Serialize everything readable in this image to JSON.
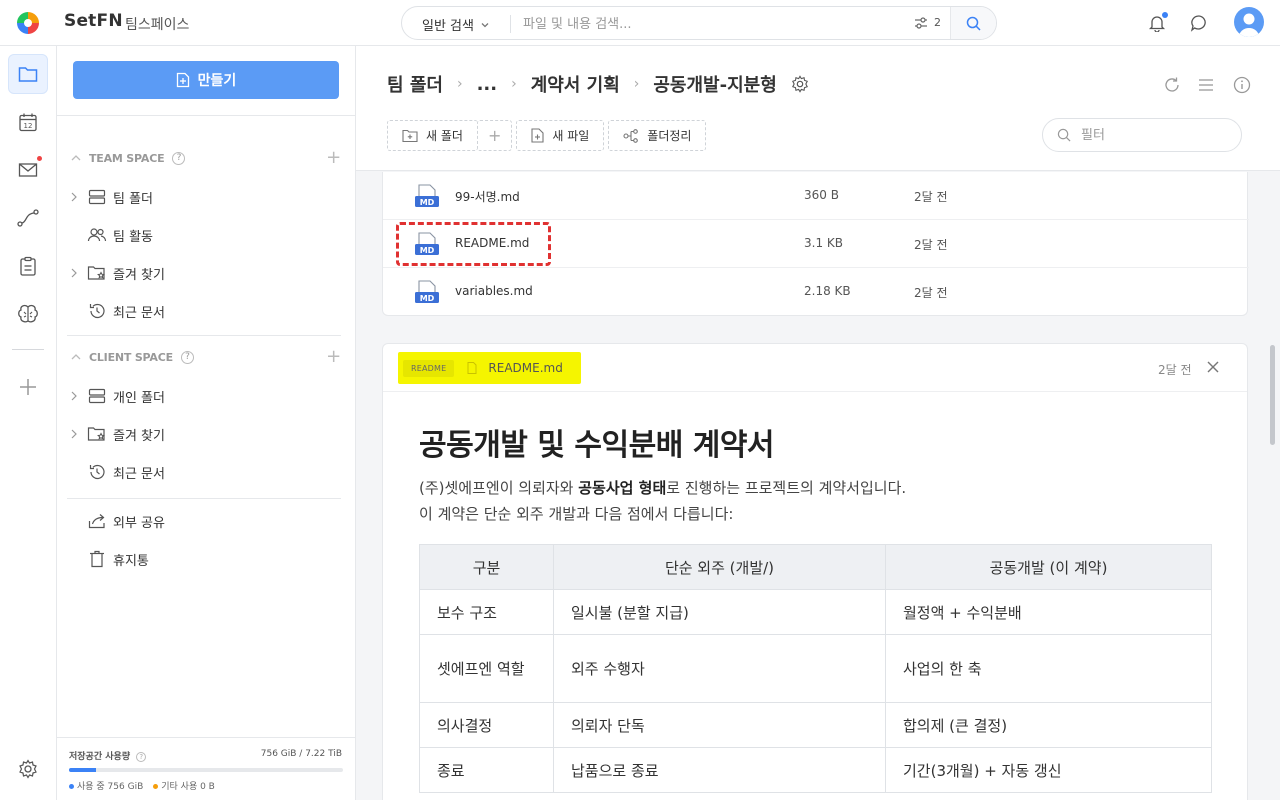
{
  "app": {
    "brand": "SetFN",
    "workspace": "팀스페이스"
  },
  "search": {
    "mode": "일반 검색",
    "placeholder": "파일 및 내용 검색...",
    "filter_count": "2"
  },
  "sidebar": {
    "create_label": "만들기",
    "team_space": {
      "title": "TEAM SPACE",
      "items": [
        {
          "label": "팀 폴더"
        },
        {
          "label": "팀 활동"
        },
        {
          "label": "즐겨 찾기"
        },
        {
          "label": "최근 문서"
        }
      ]
    },
    "client_space": {
      "title": "CLIENT SPACE",
      "items": [
        {
          "label": "개인 폴더"
        },
        {
          "label": "즐겨 찾기"
        },
        {
          "label": "최근 문서"
        }
      ]
    },
    "extra_items": [
      {
        "label": "외부 공유"
      },
      {
        "label": "휴지통"
      }
    ],
    "storage": {
      "title": "저장공간 사용량",
      "value": "756 GiB / 7.22 TiB",
      "used_fraction": 0.1,
      "legend_used": "사용 중 756 GiB",
      "legend_other": "기타 사용 0 B",
      "color_used": "#3b82f6",
      "color_other": "#f59e0b"
    }
  },
  "breadcrumb": {
    "items": [
      "팀 폴더",
      "...",
      "계약서 기획",
      "공동개발-지분형"
    ]
  },
  "actions": {
    "new_folder": "새 폴더",
    "new_file": "새 파일",
    "organize": "폴더정리",
    "filter_placeholder": "필터"
  },
  "files": [
    {
      "name": "99-서명.md",
      "size": "360 B",
      "date": "2달 전",
      "icon": "md-file-icon"
    },
    {
      "name": "README.md",
      "size": "3.1 KB",
      "date": "2달 전",
      "icon": "md-file-icon"
    },
    {
      "name": "variables.md",
      "size": "2.18 KB",
      "date": "2달 전",
      "icon": "md-file-icon"
    }
  ],
  "readme": {
    "badge": "README",
    "filename": "README.md",
    "date": "2달 전",
    "title": "공동개발 및 수익분배 계약서",
    "p1_pre": "(주)셋에프엔이 의뢰자와 ",
    "p1_bold": "공동사업 형태",
    "p1_post": "로 진행하는 프로젝트의 계약서입니다.",
    "p2": "이 계약은 단순 외주 개발과 다음 점에서 다릅니다:",
    "table": {
      "headers": [
        "구분",
        "단순 외주 (개발/)",
        "공동개발 (이 계약)"
      ],
      "rows": [
        [
          "보수 구조",
          "일시불 (분할 지급)",
          "월정액 + 수익분배"
        ],
        [
          "셋에프엔 역할",
          "외주 수행자",
          "사업의 한 축"
        ],
        [
          "의사결정",
          "의뢰자 단독",
          "합의제 (큰 결정)"
        ],
        [
          "종료",
          "납품으로 종료",
          "기간(3개월) + 자동 갱신"
        ]
      ]
    }
  },
  "colors": {
    "accent": "#5b9bf5",
    "highlight": "#f5f500",
    "annotation_red": "#e03131"
  }
}
